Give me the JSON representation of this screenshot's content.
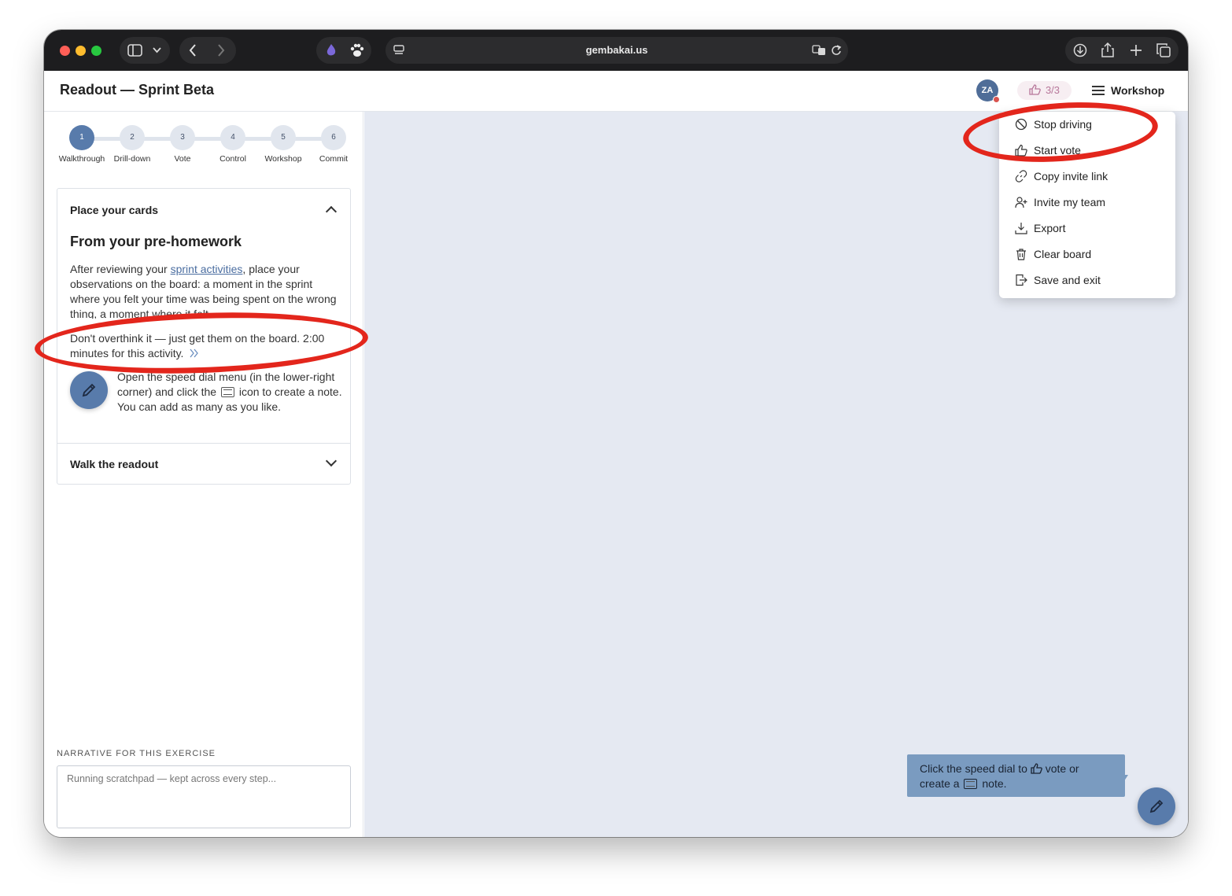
{
  "browser": {
    "url": "gembakai.us"
  },
  "header": {
    "title": "Readout — Sprint Beta",
    "avatar_initials": "ZA",
    "vote_count": "3/3",
    "menu_label": "Workshop"
  },
  "stepper": {
    "steps": [
      {
        "number": "1",
        "label": "Walkthrough"
      },
      {
        "number": "2",
        "label": "Drill-down"
      },
      {
        "number": "3",
        "label": "Vote"
      },
      {
        "number": "4",
        "label": "Control"
      },
      {
        "number": "5",
        "label": "Workshop"
      },
      {
        "number": "6",
        "label": "Commit"
      }
    ]
  },
  "accordion": {
    "section1": {
      "title": "Place your cards",
      "subtitle": "From your pre-homework",
      "para1_before": "After reviewing your ",
      "para1_link": "sprint activities",
      "para1_after": ", place your observations on the board: a moment in the sprint where you felt your time was being spent on the wrong thing, a moment where it felt",
      "para2": "Don't overthink it — just get them on the board. 2:00 minutes for this activity.",
      "para3_before": "Open the speed dial menu (in the lower-right corner) and click the ",
      "para3_after": " icon to create a note. You can add as many as you like."
    },
    "section2": {
      "title": "Walk the readout"
    }
  },
  "narrative": {
    "label": "NARRATIVE FOR THIS EXERCISE",
    "placeholder": "Running scratchpad — kept across every step..."
  },
  "menu": {
    "items": [
      {
        "label": "Stop driving",
        "icon": "ban-icon"
      },
      {
        "label": "Start vote",
        "icon": "thumbs-up-icon"
      },
      {
        "label": "Copy invite link",
        "icon": "link-icon"
      },
      {
        "label": "Invite my team",
        "icon": "user-plus-icon"
      },
      {
        "label": "Export",
        "icon": "download-icon"
      },
      {
        "label": "Clear board",
        "icon": "trash-icon"
      },
      {
        "label": "Save and exit",
        "icon": "exit-icon"
      }
    ]
  },
  "tooltip": {
    "part1": "Click the speed dial to ",
    "part2": " vote or create a ",
    "part3": " note."
  },
  "colors": {
    "accent": "#587bab",
    "board": "#e5e9f2",
    "annotation": "#e3261c",
    "vote_pill_text": "#b7779a"
  }
}
